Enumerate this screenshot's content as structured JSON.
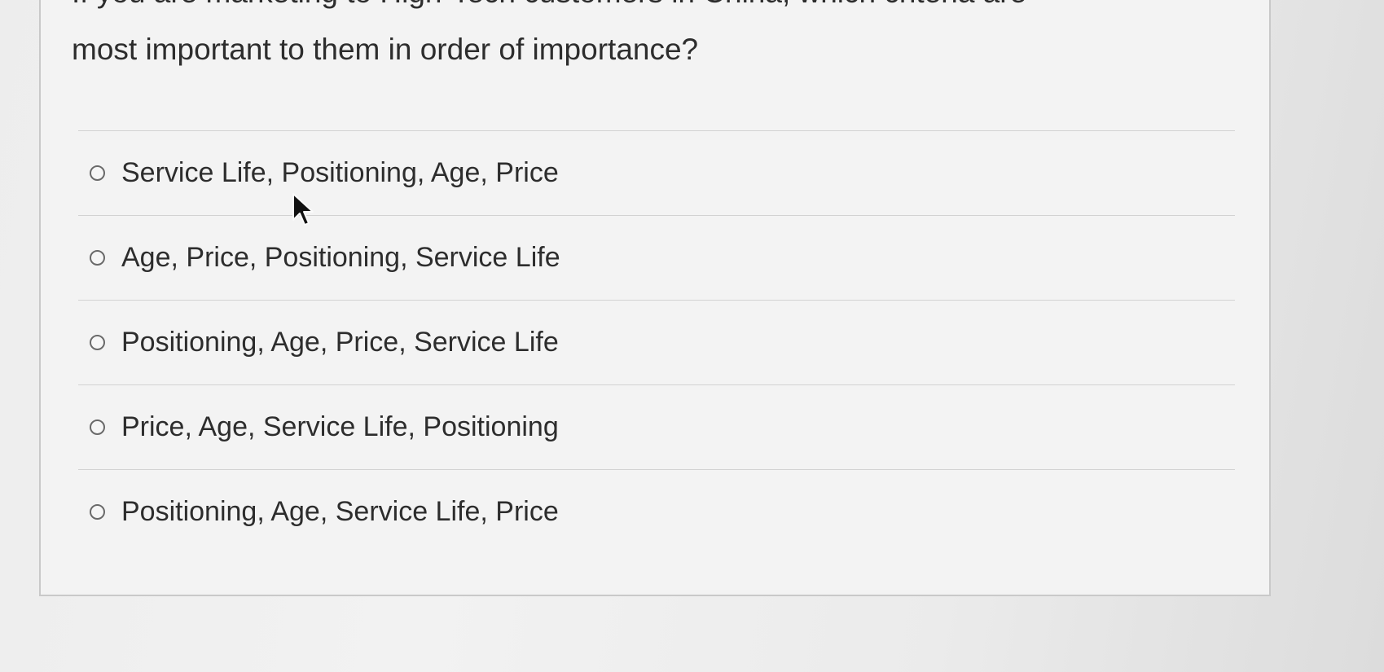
{
  "question": {
    "previous_line_fragment": "If you are marketing to High-Tech customers in China, which criteria are",
    "text": "most important to them in order of importance?"
  },
  "options": [
    {
      "label": "Service Life, Positioning, Age, Price",
      "selected": false
    },
    {
      "label": "Age, Price, Positioning, Service Life",
      "selected": false
    },
    {
      "label": "Positioning, Age, Price, Service Life",
      "selected": false
    },
    {
      "label": "Price, Age, Service Life, Positioning",
      "selected": false
    },
    {
      "label": "Positioning, Age, Service Life, Price",
      "selected": false
    }
  ],
  "cursor": {
    "icon": "arrow-pointer-icon"
  }
}
